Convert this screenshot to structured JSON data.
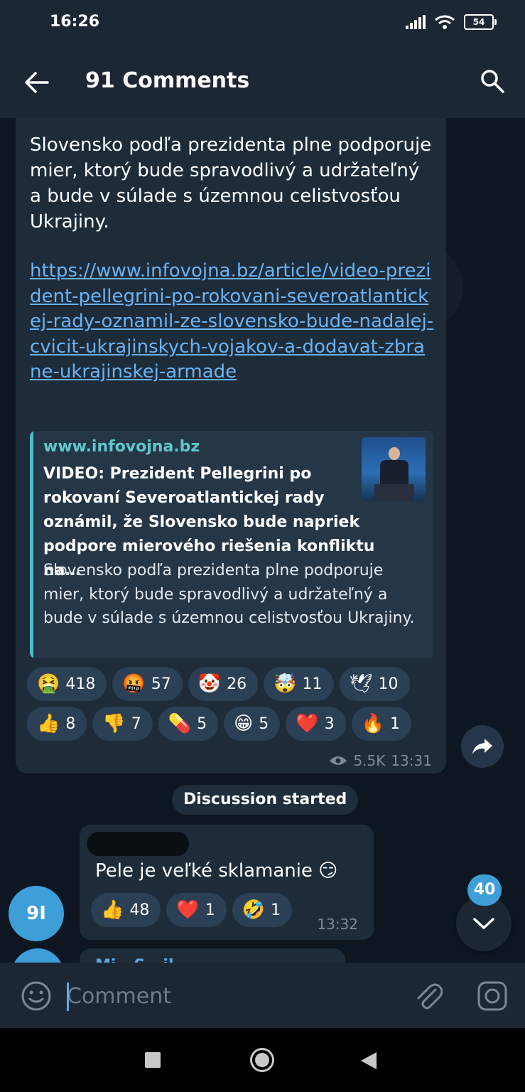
{
  "status_bar": {
    "time": "16:26",
    "battery": "54"
  },
  "header": {
    "title": "91 Comments"
  },
  "post": {
    "text": "Slovensko podľa prezidenta plne podporuje mier, ktorý bude spravodlivý a udržateľný a bude v súlade s územnou celistvosťou Ukrajiny.",
    "link": "https://www.infovojna.bz/article/video-prezident-pellegrini-po-rokovani-severoatlantickej-rady-oznamil-ze-slovensko-bude-nadalej-cvicit-ukrajinskych-vojakov-a-dodavat-zbrane-ukrajinskej-armade",
    "preview": {
      "site": "www.infovojna.bz",
      "title": "VIDEO: Prezident Pellegrini po rokovaní Severoatlantickej rady oznámil, že Slovensko bude napriek podpore mierového riešenia konfliktu na…",
      "description": "Slovensko podľa prezidenta plne podporuje mier, ktorý bude spravodlivý a udržateľný a bude v súlade s územnou celistvosťou Ukrajiny."
    },
    "reactions": [
      {
        "emoji": "🤮",
        "count": "418"
      },
      {
        "emoji": "🤬",
        "count": "57"
      },
      {
        "emoji": "🤡",
        "count": "26"
      },
      {
        "emoji": "🤯",
        "count": "11"
      },
      {
        "emoji": "🕊",
        "count": "10"
      },
      {
        "emoji": "👍",
        "count": "8"
      },
      {
        "emoji": "👎",
        "count": "7"
      },
      {
        "emoji": "💊",
        "count": "5"
      },
      {
        "emoji": "😁",
        "count": "5"
      },
      {
        "emoji": "❤️",
        "count": "3"
      },
      {
        "emoji": "🔥",
        "count": "1"
      }
    ],
    "views": "5.5K",
    "time": "13:31"
  },
  "discussion_label": "Discussion started",
  "comment": {
    "avatar_initials": "9I",
    "text": "Pele je veľké sklamanie 😏",
    "reactions": [
      {
        "emoji": "👍",
        "count": "48"
      },
      {
        "emoji": "❤️",
        "count": "1"
      },
      {
        "emoji": "🤣",
        "count": "1"
      }
    ],
    "time": "13:32"
  },
  "next_comment": {
    "author_partial": "Mi...S...il"
  },
  "unread_count": "40",
  "input": {
    "placeholder": "Comment"
  },
  "colors": {
    "accent": "#3e9ed8",
    "link": "#6ab3f3",
    "bubble": "#1e2c3a",
    "background": "#0e1621"
  }
}
